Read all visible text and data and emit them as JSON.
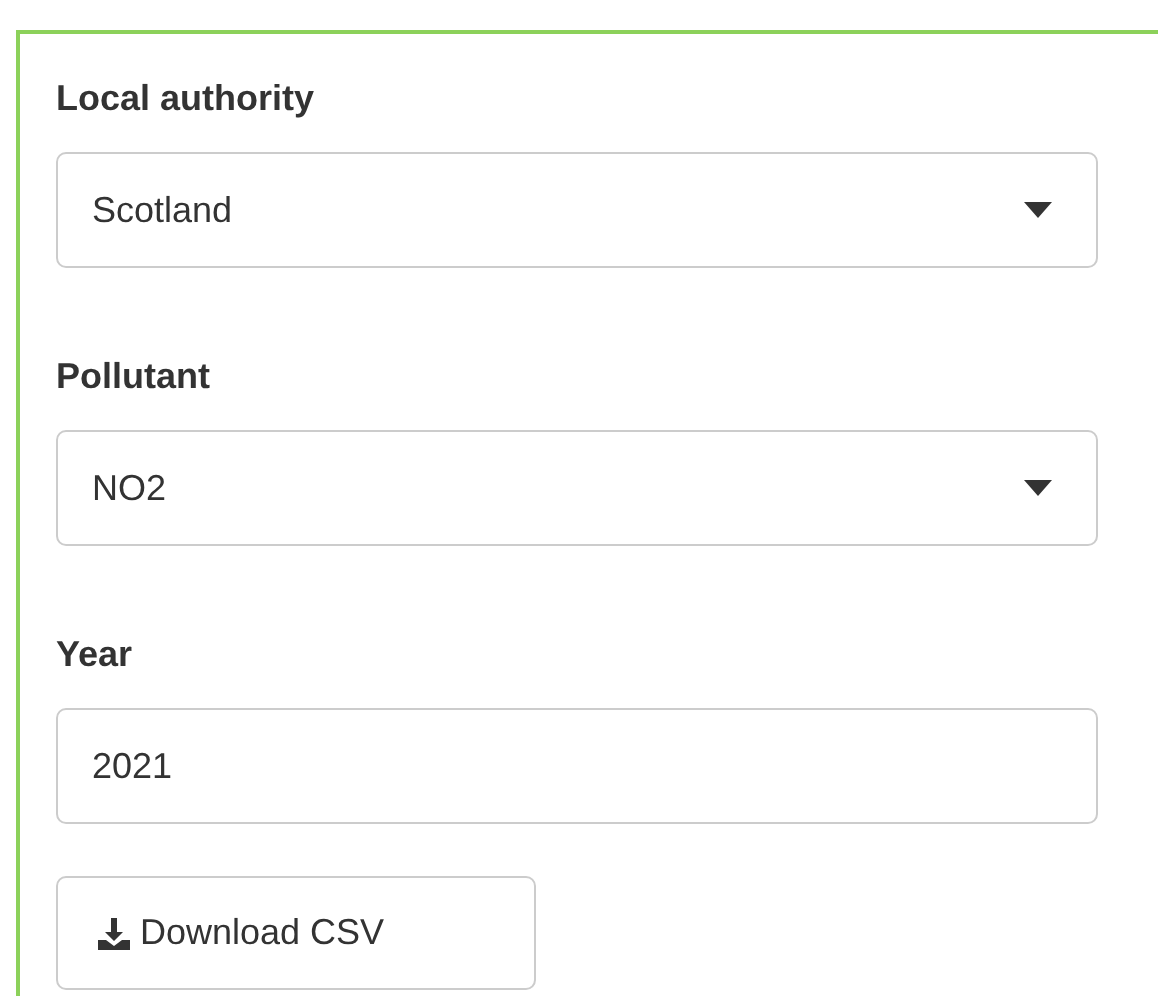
{
  "fields": [
    {
      "kind": "select",
      "label": "Local authority",
      "value": "Scotland"
    },
    {
      "kind": "select",
      "label": "Pollutant",
      "value": "NO2"
    },
    {
      "kind": "input",
      "label": "Year",
      "value": "2021"
    }
  ],
  "download_button": {
    "label": "Download CSV"
  }
}
